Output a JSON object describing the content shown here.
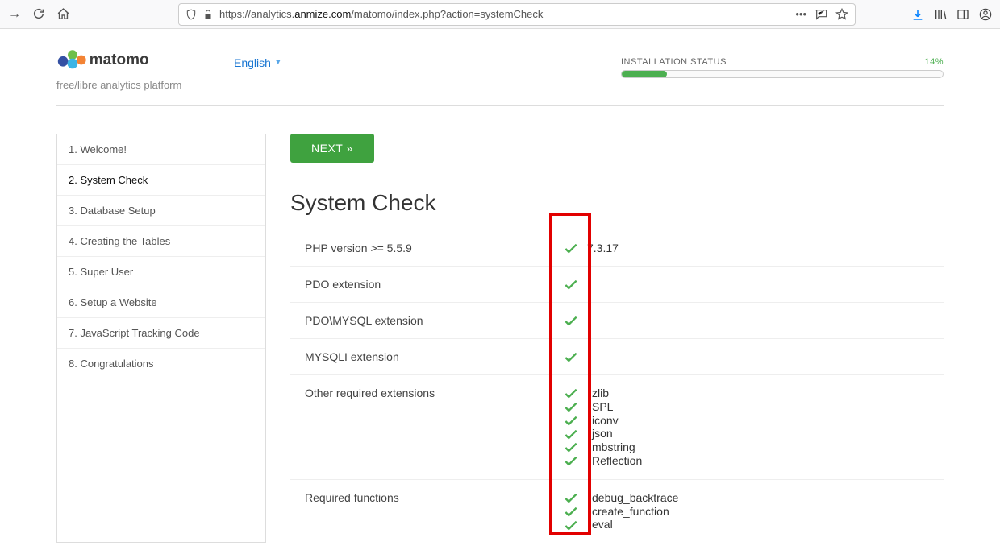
{
  "browser": {
    "url_pre": "https://analytics.",
    "url_bold": "anmize.com",
    "url_post": "/matomo/index.php?action=systemCheck"
  },
  "logo": {
    "tagline": "free/libre analytics platform"
  },
  "language": {
    "label": "English"
  },
  "install_status": {
    "label": "INSTALLATION STATUS",
    "percent": "14%"
  },
  "sidebar": {
    "items": [
      {
        "label": "1. Welcome!"
      },
      {
        "label": "2. System Check"
      },
      {
        "label": "3. Database Setup"
      },
      {
        "label": "4. Creating the Tables"
      },
      {
        "label": "5. Super User"
      },
      {
        "label": "6. Setup a Website"
      },
      {
        "label": "7. JavaScript Tracking Code"
      },
      {
        "label": "8. Congratulations"
      }
    ]
  },
  "buttons": {
    "next": "NEXT »"
  },
  "page": {
    "title": "System Check"
  },
  "checks": [
    {
      "label": "PHP version >= 5.5.9",
      "value": "7.3.17"
    },
    {
      "label": "PDO extension",
      "value": ""
    },
    {
      "label": "PDO\\MYSQL extension",
      "value": ""
    },
    {
      "label": "MYSQLI extension",
      "value": ""
    }
  ],
  "ext_group": {
    "label": "Other required extensions",
    "items": [
      "zlib",
      "SPL",
      "iconv",
      "json",
      "mbstring",
      "Reflection"
    ]
  },
  "func_group": {
    "label": "Required functions",
    "items": [
      "debug_backtrace",
      "create_function",
      "eval"
    ]
  }
}
